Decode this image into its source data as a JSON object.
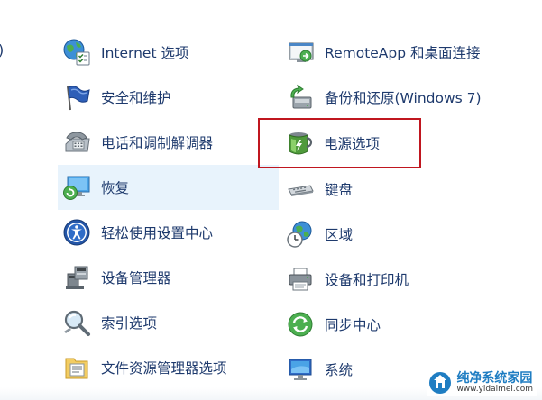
{
  "edge_fragment": ")",
  "left_column": [
    {
      "label": "Internet 选项",
      "icon": "internet-options-icon"
    },
    {
      "label": "安全和维护",
      "icon": "security-flag-icon"
    },
    {
      "label": "电话和调制解调器",
      "icon": "phone-modem-icon"
    },
    {
      "label": "恢复",
      "icon": "recovery-icon",
      "highlighted": true
    },
    {
      "label": "轻松使用设置中心",
      "icon": "ease-of-access-icon"
    },
    {
      "label": "设备管理器",
      "icon": "device-manager-icon"
    },
    {
      "label": "索引选项",
      "icon": "indexing-icon"
    },
    {
      "label": "文件资源管理器选项",
      "icon": "folder-options-icon"
    }
  ],
  "right_column": [
    {
      "label": "RemoteApp 和桌面连接",
      "icon": "remoteapp-icon"
    },
    {
      "label": "备份和还原(Windows 7)",
      "icon": "backup-restore-icon"
    },
    {
      "label": "电源选项",
      "icon": "power-options-icon",
      "outlined": true
    },
    {
      "label": "键盘",
      "icon": "keyboard-icon"
    },
    {
      "label": "区域",
      "icon": "region-icon"
    },
    {
      "label": "设备和打印机",
      "icon": "printer-icon"
    },
    {
      "label": "同步中心",
      "icon": "sync-center-icon"
    },
    {
      "label": "系统",
      "icon": "system-icon"
    }
  ],
  "watermark": {
    "title": "纯净系统家园",
    "url": "www.yidaimei.com"
  },
  "colors": {
    "link_text": "#1e3a6d",
    "hover_bg": "#e8f3fc",
    "outline_red": "#c0161f"
  }
}
